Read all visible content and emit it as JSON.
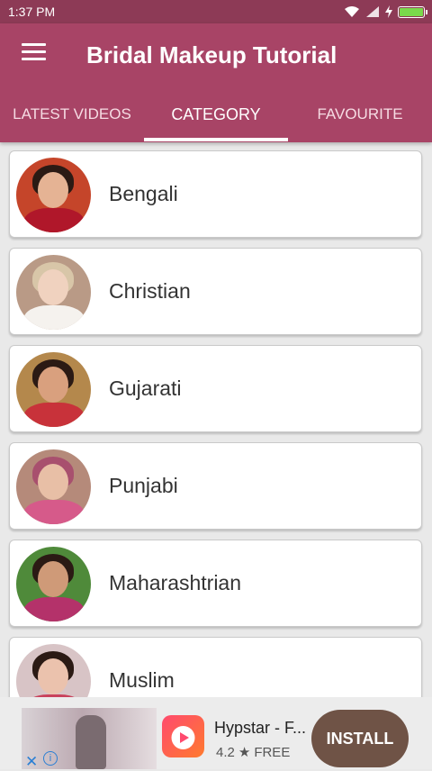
{
  "status_bar": {
    "time": "1:37 PM"
  },
  "app_bar": {
    "title": "Bridal Makeup Tutorial",
    "menu_icon": "hamburger-menu-icon"
  },
  "tabs": [
    {
      "label": "LATEST VIDEOS"
    },
    {
      "label": "CATEGORY"
    },
    {
      "label": "FAVOURITE"
    }
  ],
  "categories": [
    {
      "label": "Bengali"
    },
    {
      "label": "Christian"
    },
    {
      "label": "Gujarati"
    },
    {
      "label": "Punjabi"
    },
    {
      "label": "Maharashtrian"
    },
    {
      "label": "Muslim"
    }
  ],
  "ad": {
    "app_name": "Hypstar - F...",
    "rating": "4.2",
    "price": "FREE",
    "install_label": "INSTALL"
  },
  "colors": {
    "status_bar": "#8d3a56",
    "app_bar": "#a84466",
    "install_button": "#6f5346"
  }
}
